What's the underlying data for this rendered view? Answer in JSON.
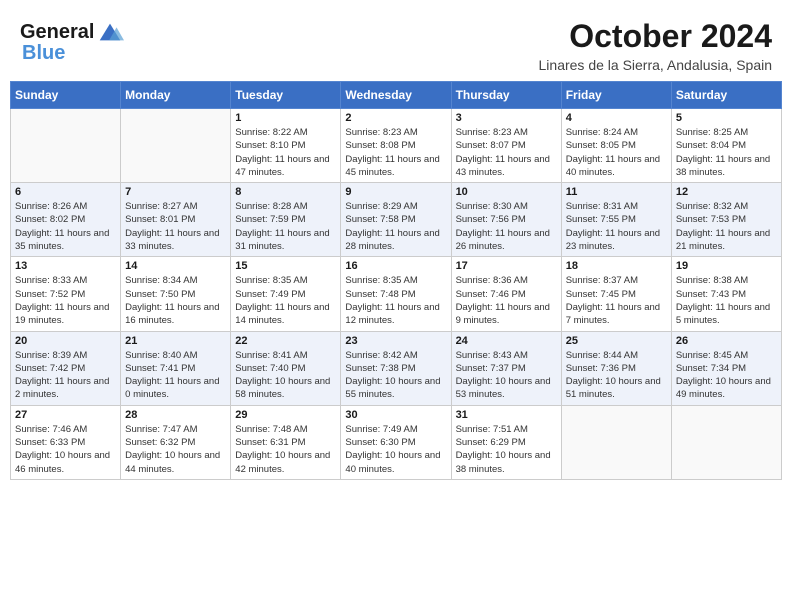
{
  "header": {
    "logo_line1": "General",
    "logo_line2": "Blue",
    "month": "October 2024",
    "location": "Linares de la Sierra, Andalusia, Spain"
  },
  "days_of_week": [
    "Sunday",
    "Monday",
    "Tuesday",
    "Wednesday",
    "Thursday",
    "Friday",
    "Saturday"
  ],
  "weeks": [
    [
      {
        "day": "",
        "sunrise": "",
        "sunset": "",
        "daylight": ""
      },
      {
        "day": "",
        "sunrise": "",
        "sunset": "",
        "daylight": ""
      },
      {
        "day": "1",
        "sunrise": "Sunrise: 8:22 AM",
        "sunset": "Sunset: 8:10 PM",
        "daylight": "Daylight: 11 hours and 47 minutes."
      },
      {
        "day": "2",
        "sunrise": "Sunrise: 8:23 AM",
        "sunset": "Sunset: 8:08 PM",
        "daylight": "Daylight: 11 hours and 45 minutes."
      },
      {
        "day": "3",
        "sunrise": "Sunrise: 8:23 AM",
        "sunset": "Sunset: 8:07 PM",
        "daylight": "Daylight: 11 hours and 43 minutes."
      },
      {
        "day": "4",
        "sunrise": "Sunrise: 8:24 AM",
        "sunset": "Sunset: 8:05 PM",
        "daylight": "Daylight: 11 hours and 40 minutes."
      },
      {
        "day": "5",
        "sunrise": "Sunrise: 8:25 AM",
        "sunset": "Sunset: 8:04 PM",
        "daylight": "Daylight: 11 hours and 38 minutes."
      }
    ],
    [
      {
        "day": "6",
        "sunrise": "Sunrise: 8:26 AM",
        "sunset": "Sunset: 8:02 PM",
        "daylight": "Daylight: 11 hours and 35 minutes."
      },
      {
        "day": "7",
        "sunrise": "Sunrise: 8:27 AM",
        "sunset": "Sunset: 8:01 PM",
        "daylight": "Daylight: 11 hours and 33 minutes."
      },
      {
        "day": "8",
        "sunrise": "Sunrise: 8:28 AM",
        "sunset": "Sunset: 7:59 PM",
        "daylight": "Daylight: 11 hours and 31 minutes."
      },
      {
        "day": "9",
        "sunrise": "Sunrise: 8:29 AM",
        "sunset": "Sunset: 7:58 PM",
        "daylight": "Daylight: 11 hours and 28 minutes."
      },
      {
        "day": "10",
        "sunrise": "Sunrise: 8:30 AM",
        "sunset": "Sunset: 7:56 PM",
        "daylight": "Daylight: 11 hours and 26 minutes."
      },
      {
        "day": "11",
        "sunrise": "Sunrise: 8:31 AM",
        "sunset": "Sunset: 7:55 PM",
        "daylight": "Daylight: 11 hours and 23 minutes."
      },
      {
        "day": "12",
        "sunrise": "Sunrise: 8:32 AM",
        "sunset": "Sunset: 7:53 PM",
        "daylight": "Daylight: 11 hours and 21 minutes."
      }
    ],
    [
      {
        "day": "13",
        "sunrise": "Sunrise: 8:33 AM",
        "sunset": "Sunset: 7:52 PM",
        "daylight": "Daylight: 11 hours and 19 minutes."
      },
      {
        "day": "14",
        "sunrise": "Sunrise: 8:34 AM",
        "sunset": "Sunset: 7:50 PM",
        "daylight": "Daylight: 11 hours and 16 minutes."
      },
      {
        "day": "15",
        "sunrise": "Sunrise: 8:35 AM",
        "sunset": "Sunset: 7:49 PM",
        "daylight": "Daylight: 11 hours and 14 minutes."
      },
      {
        "day": "16",
        "sunrise": "Sunrise: 8:35 AM",
        "sunset": "Sunset: 7:48 PM",
        "daylight": "Daylight: 11 hours and 12 minutes."
      },
      {
        "day": "17",
        "sunrise": "Sunrise: 8:36 AM",
        "sunset": "Sunset: 7:46 PM",
        "daylight": "Daylight: 11 hours and 9 minutes."
      },
      {
        "day": "18",
        "sunrise": "Sunrise: 8:37 AM",
        "sunset": "Sunset: 7:45 PM",
        "daylight": "Daylight: 11 hours and 7 minutes."
      },
      {
        "day": "19",
        "sunrise": "Sunrise: 8:38 AM",
        "sunset": "Sunset: 7:43 PM",
        "daylight": "Daylight: 11 hours and 5 minutes."
      }
    ],
    [
      {
        "day": "20",
        "sunrise": "Sunrise: 8:39 AM",
        "sunset": "Sunset: 7:42 PM",
        "daylight": "Daylight: 11 hours and 2 minutes."
      },
      {
        "day": "21",
        "sunrise": "Sunrise: 8:40 AM",
        "sunset": "Sunset: 7:41 PM",
        "daylight": "Daylight: 11 hours and 0 minutes."
      },
      {
        "day": "22",
        "sunrise": "Sunrise: 8:41 AM",
        "sunset": "Sunset: 7:40 PM",
        "daylight": "Daylight: 10 hours and 58 minutes."
      },
      {
        "day": "23",
        "sunrise": "Sunrise: 8:42 AM",
        "sunset": "Sunset: 7:38 PM",
        "daylight": "Daylight: 10 hours and 55 minutes."
      },
      {
        "day": "24",
        "sunrise": "Sunrise: 8:43 AM",
        "sunset": "Sunset: 7:37 PM",
        "daylight": "Daylight: 10 hours and 53 minutes."
      },
      {
        "day": "25",
        "sunrise": "Sunrise: 8:44 AM",
        "sunset": "Sunset: 7:36 PM",
        "daylight": "Daylight: 10 hours and 51 minutes."
      },
      {
        "day": "26",
        "sunrise": "Sunrise: 8:45 AM",
        "sunset": "Sunset: 7:34 PM",
        "daylight": "Daylight: 10 hours and 49 minutes."
      }
    ],
    [
      {
        "day": "27",
        "sunrise": "Sunrise: 7:46 AM",
        "sunset": "Sunset: 6:33 PM",
        "daylight": "Daylight: 10 hours and 46 minutes."
      },
      {
        "day": "28",
        "sunrise": "Sunrise: 7:47 AM",
        "sunset": "Sunset: 6:32 PM",
        "daylight": "Daylight: 10 hours and 44 minutes."
      },
      {
        "day": "29",
        "sunrise": "Sunrise: 7:48 AM",
        "sunset": "Sunset: 6:31 PM",
        "daylight": "Daylight: 10 hours and 42 minutes."
      },
      {
        "day": "30",
        "sunrise": "Sunrise: 7:49 AM",
        "sunset": "Sunset: 6:30 PM",
        "daylight": "Daylight: 10 hours and 40 minutes."
      },
      {
        "day": "31",
        "sunrise": "Sunrise: 7:51 AM",
        "sunset": "Sunset: 6:29 PM",
        "daylight": "Daylight: 10 hours and 38 minutes."
      },
      {
        "day": "",
        "sunrise": "",
        "sunset": "",
        "daylight": ""
      },
      {
        "day": "",
        "sunrise": "",
        "sunset": "",
        "daylight": ""
      }
    ]
  ]
}
